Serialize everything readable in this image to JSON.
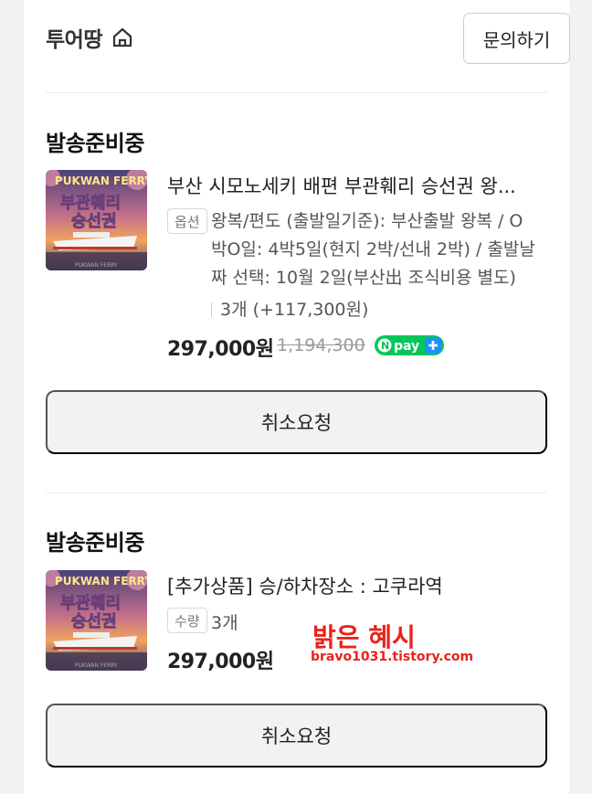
{
  "store": {
    "name": "투어땅",
    "home_icon": "home-icon",
    "inquiry_label": "문의하기"
  },
  "orders": [
    {
      "status": "발송준비중",
      "thumbnail": {
        "brand": "PUKWAN FERRY",
        "title_line1": "부관훼리",
        "title_line2": "승선권",
        "footer": "PUKWAN FERRY"
      },
      "title": "부산 시모노세키 배편 부관훼리 승선권 왕...",
      "tag": "옵션",
      "option_lines": [
        "왕복/편도 (출발일기준): 부산출발 왕복 / O",
        "박O일: 4박5일(현지 2박/선내 2박) / 출발날",
        "짜 선택: 10월 2일(부산出 조식비용 별도)"
      ],
      "quantity": "3개 (+117,300원)",
      "price": "297,000원",
      "original_price": "1,194,300",
      "badge": "N pay +",
      "cancel_label": "취소요청"
    },
    {
      "status": "발송준비중",
      "thumbnail": {
        "brand": "PUKWAN FERRY",
        "title_line1": "부관훼리",
        "title_line2": "승선권",
        "footer": "PUKWAN FERRY"
      },
      "title": "[추가상품] 승/하차장소 : 고쿠라역",
      "tag": "수량",
      "quantity": "3개",
      "price": "297,000원",
      "cancel_label": "취소요청"
    }
  ],
  "watermark": {
    "top": "밝은 혜시",
    "bottom": "bravo1031.tistory.com"
  },
  "colors": {
    "npay_green": "#03c75a",
    "npay_plus_blue": "#1e90ff",
    "button_bg": "#f1f2f4",
    "watermark_red": "#e8231c"
  }
}
